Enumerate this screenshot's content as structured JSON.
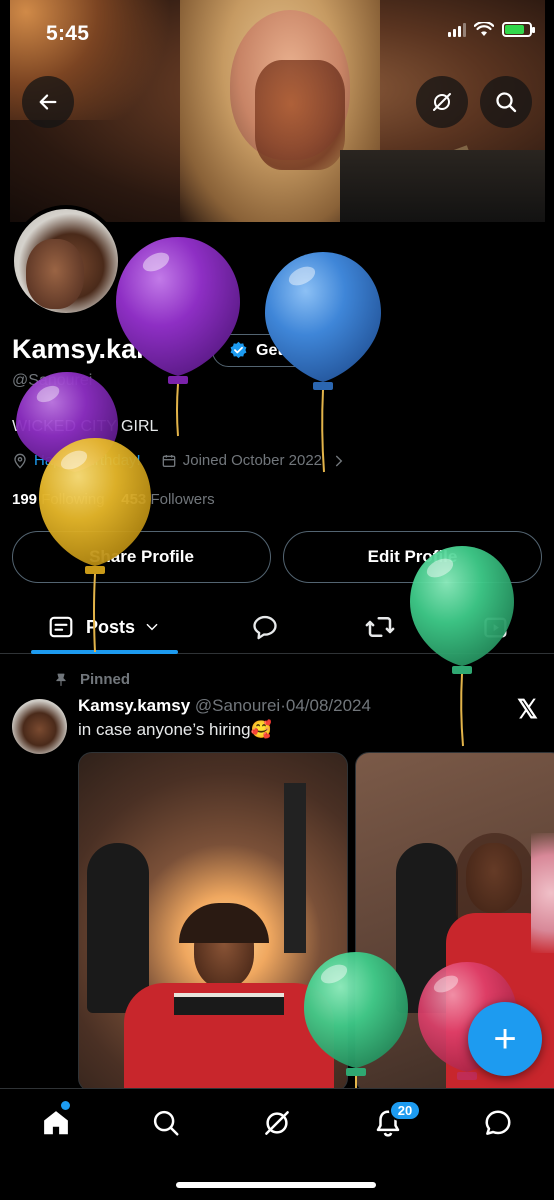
{
  "status_bar": {
    "time": "5:45"
  },
  "profile": {
    "name": "Kamsy.kamsy",
    "get_verified_label": "Get verified",
    "handle": "@Sanourei",
    "bio": "WICKED CITY GIRL",
    "birthday": "Happy Birthday!",
    "joined": "Joined October 2022",
    "following_count": "199",
    "following_label": "Following",
    "followers_count": "453",
    "followers_label": "Followers",
    "share_button": "Share Profile",
    "edit_button": "Edit Profile"
  },
  "tabs": {
    "posts_label": "Posts"
  },
  "tweet": {
    "pinned_label": "Pinned",
    "author_name": "Kamsy.kamsy",
    "author_handle": "@Sanourei",
    "separator": "·",
    "date": "04/08/2024",
    "text": "in case anyone’s hiring🥰"
  },
  "fab_label": "+",
  "bottom_nav": {
    "notifications_badge": "20"
  },
  "colors": {
    "accent": "#1d9bf0",
    "balloon_purple": "#8e2fc4",
    "balloon_blue": "#3f86d8",
    "balloon_yellow": "#e7b82a",
    "balloon_green": "#3fcc8a",
    "balloon_pink": "#e0406c"
  }
}
